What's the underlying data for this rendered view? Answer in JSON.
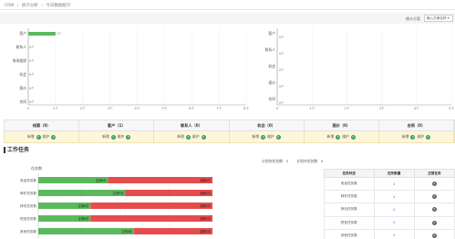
{
  "breadcrumb": {
    "items": [
      "CRM",
      "统计分析",
      "今日数据统计"
    ]
  },
  "filter": {
    "label": "统计方案",
    "selected": "输入方案名称 ▾"
  },
  "left_chart": {
    "categories": [
      "客户",
      "联系人",
      "联系跟踪",
      "机会",
      "报价",
      "合同"
    ],
    "values": [
      1,
      0,
      0,
      0,
      0,
      0
    ],
    "unit": "个",
    "value_labels": [
      "1个",
      "0个",
      "0个",
      "0个",
      "0个",
      "0个"
    ],
    "x_ticks": [
      "0",
      "1个",
      "2个",
      "3个",
      "4个",
      "5个",
      "6个",
      "7个",
      "8个"
    ]
  },
  "right_chart": {
    "categories": [
      "客户",
      "联系人",
      "机会",
      "报价",
      "合同"
    ],
    "value_labels": [
      "0个",
      "0个",
      "0个",
      "0个",
      "0个"
    ],
    "x_ticks": [
      "0",
      "1个",
      "2个",
      "3个",
      "4个",
      "5个"
    ]
  },
  "summary": {
    "headers": [
      "线索（0）",
      "客户（1）",
      "联系人（0）",
      "机会（0）",
      "报价（0）",
      "合同（0）"
    ],
    "new_label": "新增",
    "maintain_label": "维护",
    "new_counts": [
      "0",
      "1",
      "0",
      "0",
      "0",
      "0"
    ],
    "maintain_counts": [
      "0",
      "0",
      "0",
      "0",
      "0",
      "0"
    ]
  },
  "tasks": {
    "title": "工作任务",
    "chart_label": "任务数",
    "stats": [
      "计划内任务数：5",
      "计划外任务数：5"
    ],
    "chart_categories": [
      "电话任务数",
      "邮件任务数",
      "拜访任务数",
      "短信任务数",
      "其他任务数"
    ],
    "done_labels": [
      "正常8次",
      "正常5次",
      "正常8次",
      "正常8次",
      "正常8次"
    ],
    "late_labels": [
      "超期8次",
      "超期5次",
      "超期5次",
      "超期5次",
      "超期5次"
    ],
    "done_fractions": [
      0.4,
      0.5,
      0.3,
      0.3,
      0.55
    ],
    "table": {
      "headers": [
        "任务状态",
        "任务数量",
        "正常任务"
      ],
      "rows": [
        {
          "status": "电话任务数",
          "count": "4",
          "normal": "2"
        },
        {
          "status": "邮件任务数",
          "count": "4",
          "normal": "2"
        },
        {
          "status": "拜访任务数",
          "count": "4",
          "normal": "2"
        },
        {
          "status": "短信任务数",
          "count": "4",
          "normal": "2"
        },
        {
          "status": "其他任务数",
          "count": "4",
          "normal": "2"
        }
      ]
    }
  },
  "colors": {
    "green": "#5cb85c",
    "red": "#e74c4c",
    "accent": "#3c9f5e"
  }
}
